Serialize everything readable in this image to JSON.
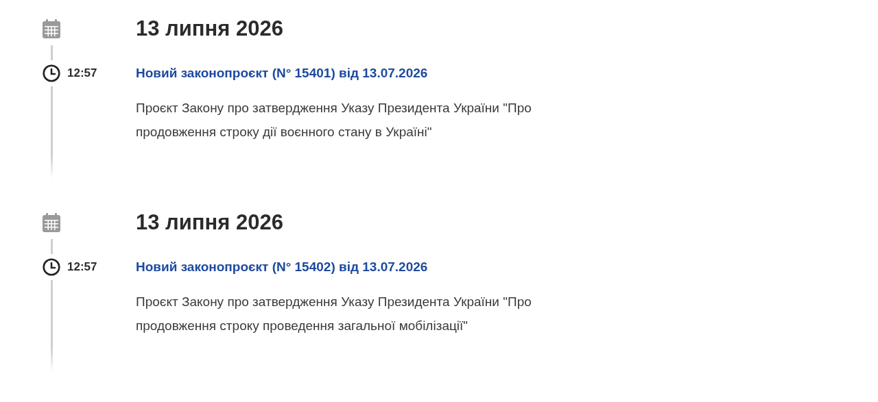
{
  "entries": [
    {
      "date": "13 липня 2026",
      "time": "12:57",
      "title": "Новий законопроєкт (N° 15401) від 13.07.2026",
      "description": "Проєкт Закону про затвердження Указу Президента України \"Про продовження строку дії воєнного стану в Україні\""
    },
    {
      "date": "13 липня 2026",
      "time": "12:57",
      "title": "Новий законопроєкт (N° 15402) від 13.07.2026",
      "description": "Проєкт Закону про затвердження Указу Президента України \"Про продовження строку проведення загальної мобілізації\""
    }
  ]
}
